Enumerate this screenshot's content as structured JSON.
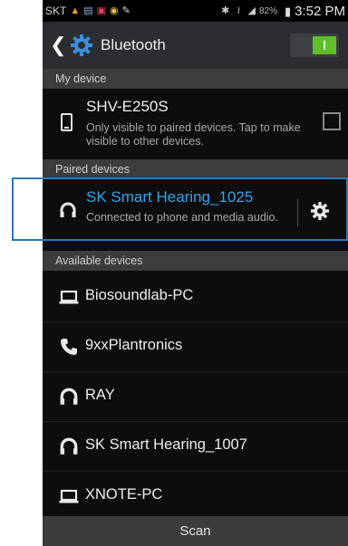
{
  "status_bar": {
    "carrier": "SKT",
    "battery": "82%",
    "time": "3:52 PM"
  },
  "action_bar": {
    "title": "Bluetooth",
    "toggle_on": true
  },
  "my_device": {
    "section_title": "My device",
    "name": "SHV-E250S",
    "description": "Only visible to paired devices. Tap to make visible to other devices."
  },
  "paired": {
    "section_title": "Paired devices",
    "name": "SK Smart Hearing_1025",
    "status": "Connected to phone and media audio."
  },
  "available": {
    "section_title": "Available devices",
    "devices": [
      {
        "name": "Biosoundlab-PC",
        "icon": "laptop-icon"
      },
      {
        "name": "9xxPlantronics",
        "icon": "phone-handset-icon"
      },
      {
        "name": "RAY",
        "icon": "headphones-icon"
      },
      {
        "name": "SK Smart Hearing_1007",
        "icon": "headphones-icon"
      },
      {
        "name": "XNOTE-PC",
        "icon": "laptop-icon"
      }
    ]
  },
  "scan_label": "Scan",
  "colors": {
    "accent_blue": "#36a3e8",
    "toggle_green": "#5fbf2a",
    "highlight_border": "#2e78b7"
  }
}
